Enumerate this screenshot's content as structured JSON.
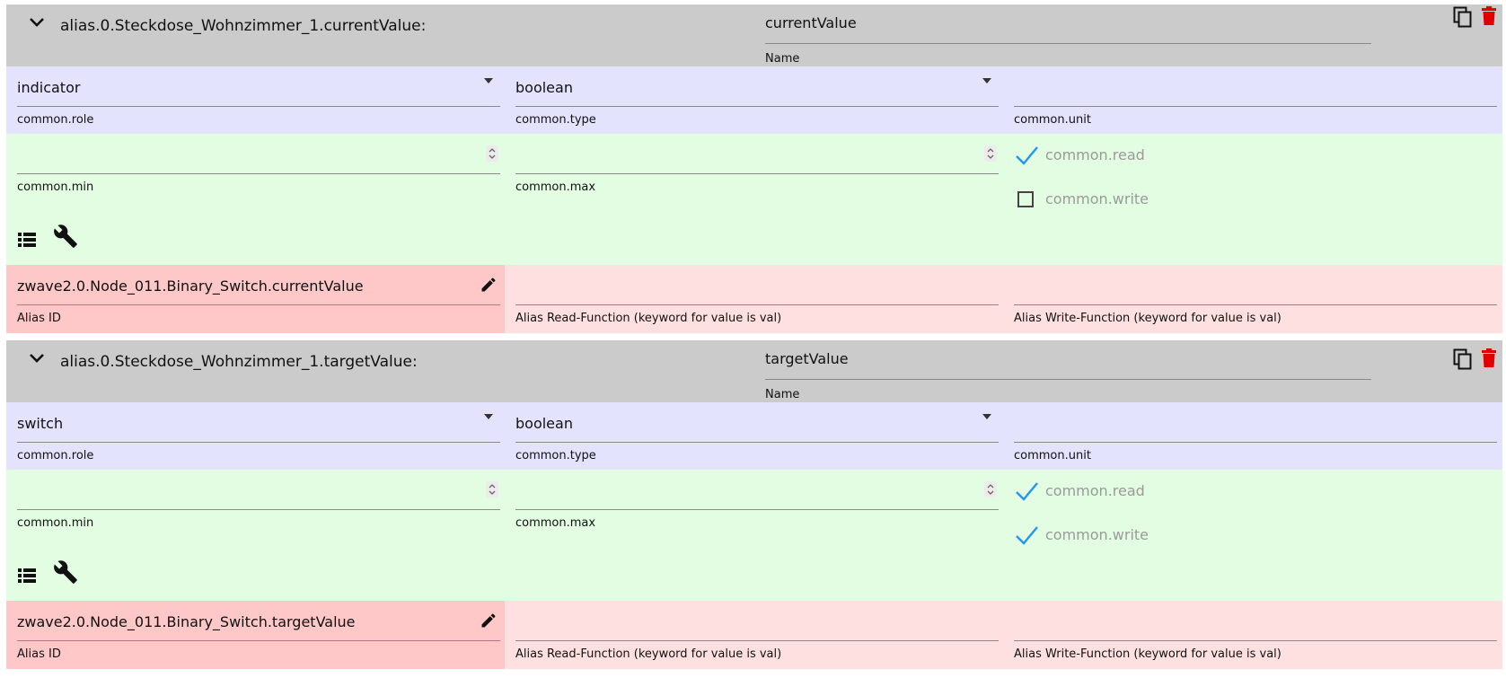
{
  "labels": {
    "name": "Name",
    "role": "common.role",
    "type": "common.type",
    "unit": "common.unit",
    "min": "common.min",
    "max": "common.max",
    "read": "common.read",
    "write": "common.write",
    "alias_id": "Alias ID",
    "read_fn": "Alias Read-Function (keyword for value is val)",
    "write_fn": "Alias Write-Function (keyword for value is val)"
  },
  "items": [
    {
      "object_id": "alias.0.Steckdose_Wohnzimmer_1.currentValue:",
      "name": "currentValue",
      "role": "indicator",
      "type": "boolean",
      "unit": "",
      "min": "",
      "max": "",
      "read": true,
      "write": false,
      "alias_id": "zwave2.0.Node_011.Binary_Switch.currentValue",
      "read_fn": "",
      "write_fn": ""
    },
    {
      "object_id": "alias.0.Steckdose_Wohnzimmer_1.targetValue:",
      "name": "targetValue",
      "role": "switch",
      "type": "boolean",
      "unit": "",
      "min": "",
      "max": "",
      "read": true,
      "write": true,
      "alias_id": "zwave2.0.Node_011.Binary_Switch.targetValue",
      "read_fn": "",
      "write_fn": ""
    }
  ],
  "colors": {
    "header": "#cbcbcb",
    "role_row": "#e3e3fd",
    "common_row": "#e2fde1",
    "alias_id_cell": "#ffc8c8",
    "alias_row": "#ffe0e0",
    "check": "#2196f3",
    "delete": "#e00000"
  },
  "icons": [
    "chevron-down-icon",
    "copy-icon",
    "delete-icon",
    "list-icon",
    "wrench-icon",
    "edit-pencil-icon",
    "check-icon",
    "checkbox-unchecked-icon"
  ]
}
